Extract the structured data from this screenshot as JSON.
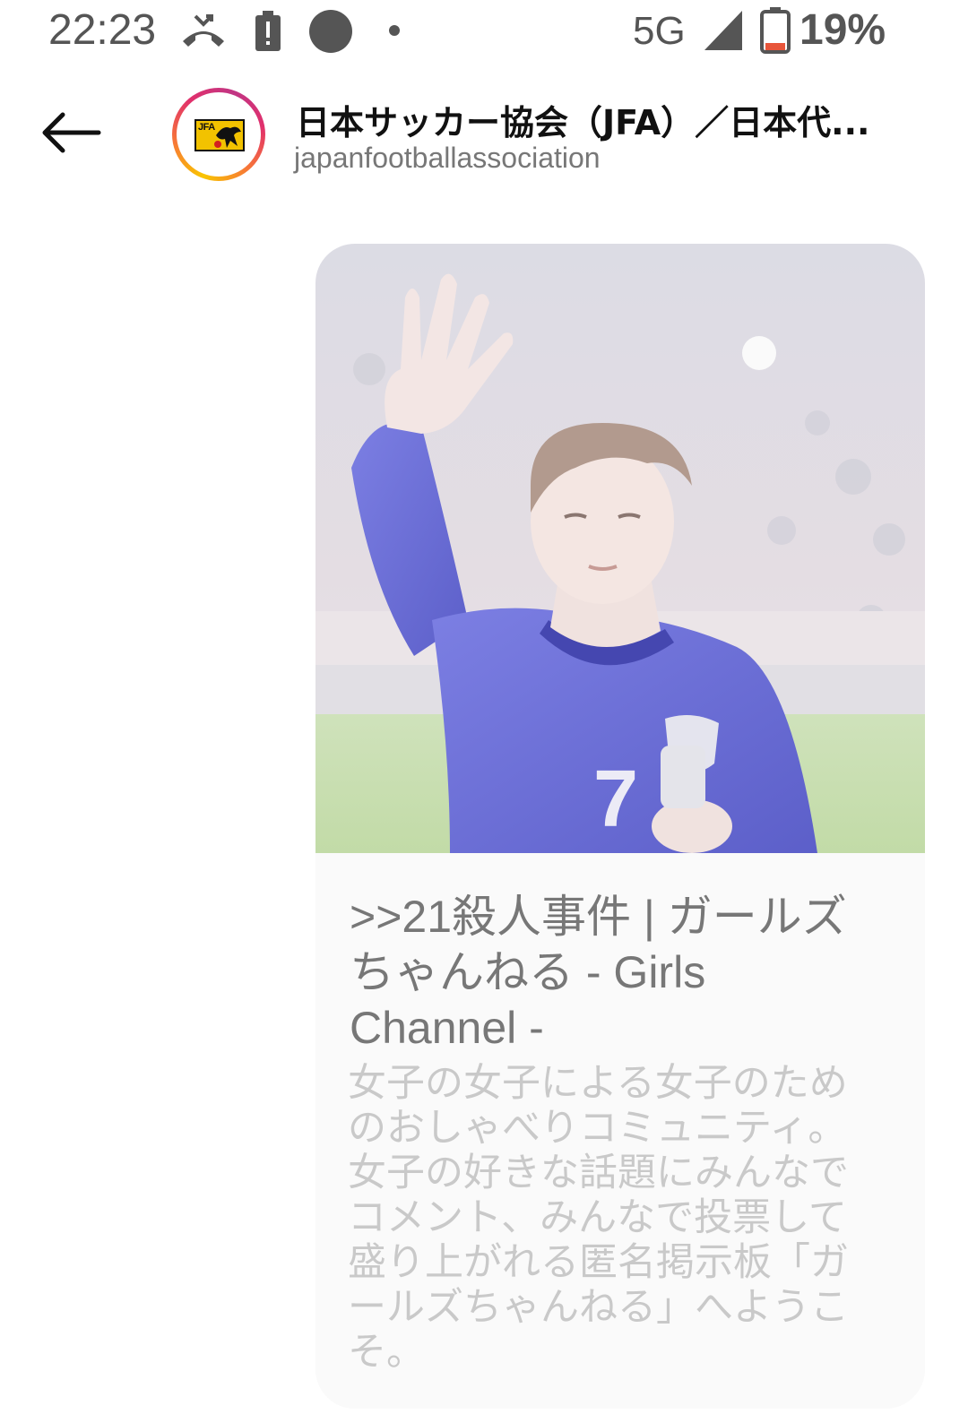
{
  "status_bar": {
    "time": "22:23",
    "network": "5G",
    "battery": "19%",
    "icons": [
      "missed-call-icon",
      "battery-alert-icon",
      "record-dot-icon",
      "notification-dot-icon",
      "signal-icon",
      "battery-icon"
    ]
  },
  "header": {
    "back_icon": "back-arrow-icon",
    "title": "日本サッカー協会（JFA）／日本代...",
    "username": "japanfootballassociation",
    "avatar_logo_text": "JFA"
  },
  "link_preview": {
    "title": ">>21殺人事件 | ガールズちゃんねる - Girls Channel -",
    "description": "女子の女子による女子のためのおしゃべりコミュニティ。女子の好きな話題にみんなでコメント、みんなで投票して盛り上がれる匿名掲示板「ガールズちゃんねる」へようこそ。"
  },
  "colors": {
    "sky_blue_kit": "#6d6fd9",
    "pitch_green": "#c9e0b0",
    "title_text": "#777777",
    "description_text": "#c9c9c9"
  }
}
